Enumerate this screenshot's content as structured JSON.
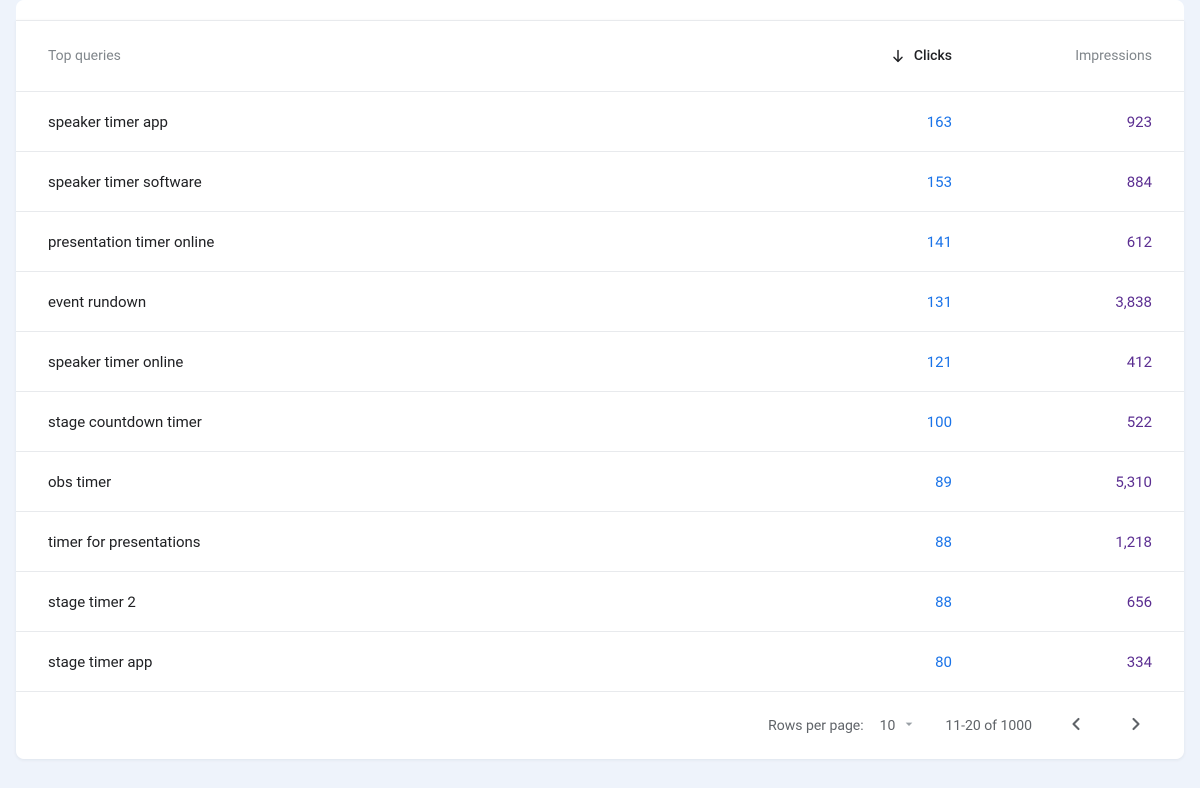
{
  "table": {
    "headers": {
      "query": "Top queries",
      "clicks": "Clicks",
      "impressions": "Impressions"
    },
    "rows": [
      {
        "query": "speaker timer app",
        "clicks": "163",
        "impressions": "923"
      },
      {
        "query": "speaker timer software",
        "clicks": "153",
        "impressions": "884"
      },
      {
        "query": "presentation timer online",
        "clicks": "141",
        "impressions": "612"
      },
      {
        "query": "event rundown",
        "clicks": "131",
        "impressions": "3,838"
      },
      {
        "query": "speaker timer online",
        "clicks": "121",
        "impressions": "412"
      },
      {
        "query": "stage countdown timer",
        "clicks": "100",
        "impressions": "522"
      },
      {
        "query": "obs timer",
        "clicks": "89",
        "impressions": "5,310"
      },
      {
        "query": "timer for presentations",
        "clicks": "88",
        "impressions": "1,218"
      },
      {
        "query": "stage timer 2",
        "clicks": "88",
        "impressions": "656"
      },
      {
        "query": "stage timer app",
        "clicks": "80",
        "impressions": "334"
      }
    ]
  },
  "pagination": {
    "rows_per_page_label": "Rows per page:",
    "page_size": "10",
    "range": "11-20 of 1000"
  }
}
